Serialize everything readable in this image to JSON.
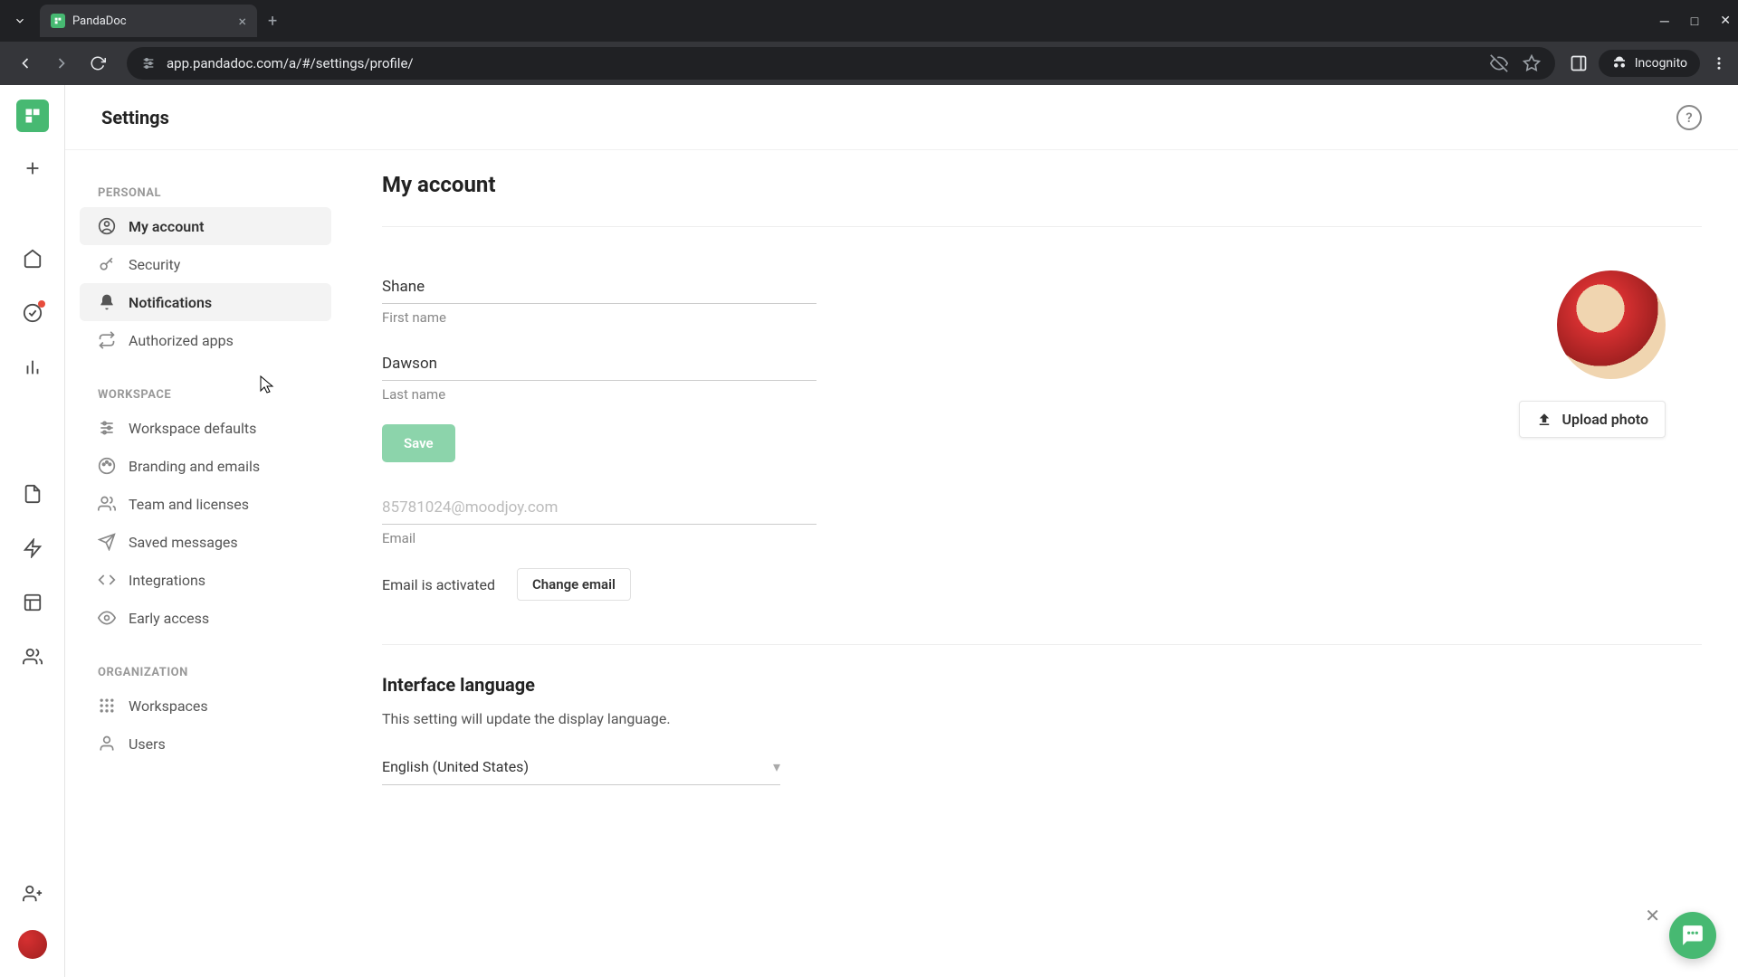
{
  "browser": {
    "tab_title": "PandaDoc",
    "url": "app.pandadoc.com/a/#/settings/profile/",
    "incognito_label": "Incognito"
  },
  "header": {
    "title": "Settings"
  },
  "sidebar": {
    "sections": {
      "personal": {
        "label": "PERSONAL",
        "items": [
          {
            "label": "My account"
          },
          {
            "label": "Security"
          },
          {
            "label": "Notifications"
          },
          {
            "label": "Authorized apps"
          }
        ]
      },
      "workspace": {
        "label": "WORKSPACE",
        "items": [
          {
            "label": "Workspace defaults"
          },
          {
            "label": "Branding and emails"
          },
          {
            "label": "Team and licenses"
          },
          {
            "label": "Saved messages"
          },
          {
            "label": "Integrations"
          },
          {
            "label": "Early access"
          }
        ]
      },
      "organization": {
        "label": "ORGANIZATION",
        "items": [
          {
            "label": "Workspaces"
          },
          {
            "label": "Users"
          }
        ]
      }
    }
  },
  "panel": {
    "title": "My account",
    "first_name": {
      "value": "Shane",
      "label": "First name"
    },
    "last_name": {
      "value": "Dawson",
      "label": "Last name"
    },
    "save_label": "Save",
    "email": {
      "value": "85781024@moodjoy.com",
      "label": "Email",
      "status": "Email is activated",
      "change_label": "Change email"
    },
    "upload_label": "Upload photo",
    "language": {
      "heading": "Interface language",
      "description": "This setting will update the display language.",
      "value": "English (United States)"
    }
  }
}
